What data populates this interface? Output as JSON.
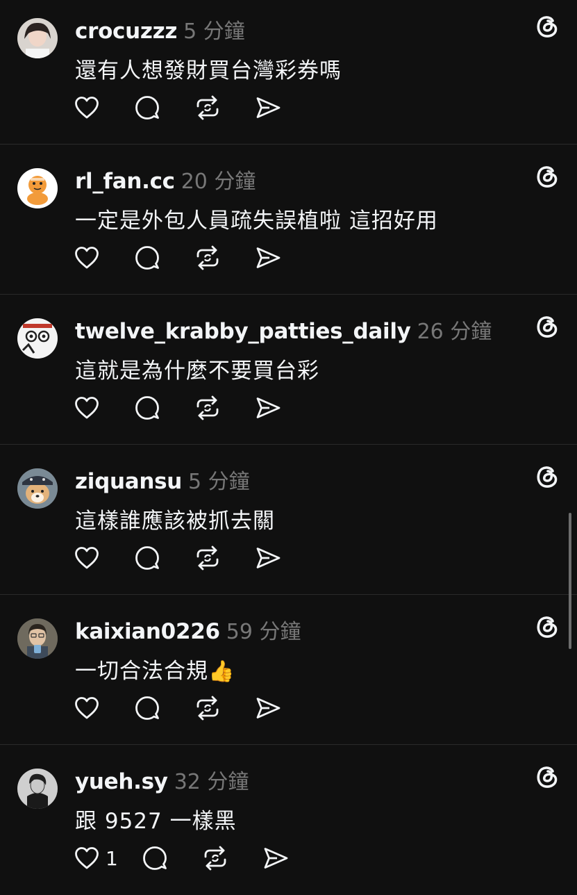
{
  "posts": [
    {
      "username": "crocuzzz",
      "time": "5 分鐘",
      "content": "還有人想發財買台灣彩券嗎",
      "emoji": "",
      "likes": ""
    },
    {
      "username": "rl_fan.cc",
      "time": "20 分鐘",
      "content": "一定是外包人員疏失誤植啦 這招好用",
      "emoji": "",
      "likes": ""
    },
    {
      "username": "twelve_krabby_patties_daily",
      "time": "26 分鐘",
      "content": "這就是為什麼不要買台彩",
      "emoji": "",
      "likes": ""
    },
    {
      "username": "ziquansu",
      "time": "5 分鐘",
      "content": "這樣誰應該被抓去關",
      "emoji": "",
      "likes": ""
    },
    {
      "username": "kaixian0226",
      "time": "59 分鐘",
      "content": "一切合法合規",
      "emoji": "👍",
      "likes": ""
    },
    {
      "username": "yueh.sy",
      "time": "32 分鐘",
      "content": "跟 9527 一樣黑",
      "emoji": "",
      "likes": "1"
    }
  ],
  "icons": {
    "like": "heart-icon",
    "reply": "comment-icon",
    "repost": "repost-icon",
    "share": "send-icon",
    "brand": "threads-logo-icon"
  },
  "colors": {
    "background": "#101010",
    "text": "#f3f5f7",
    "muted": "#777777",
    "divider": "#2a2a2a"
  }
}
